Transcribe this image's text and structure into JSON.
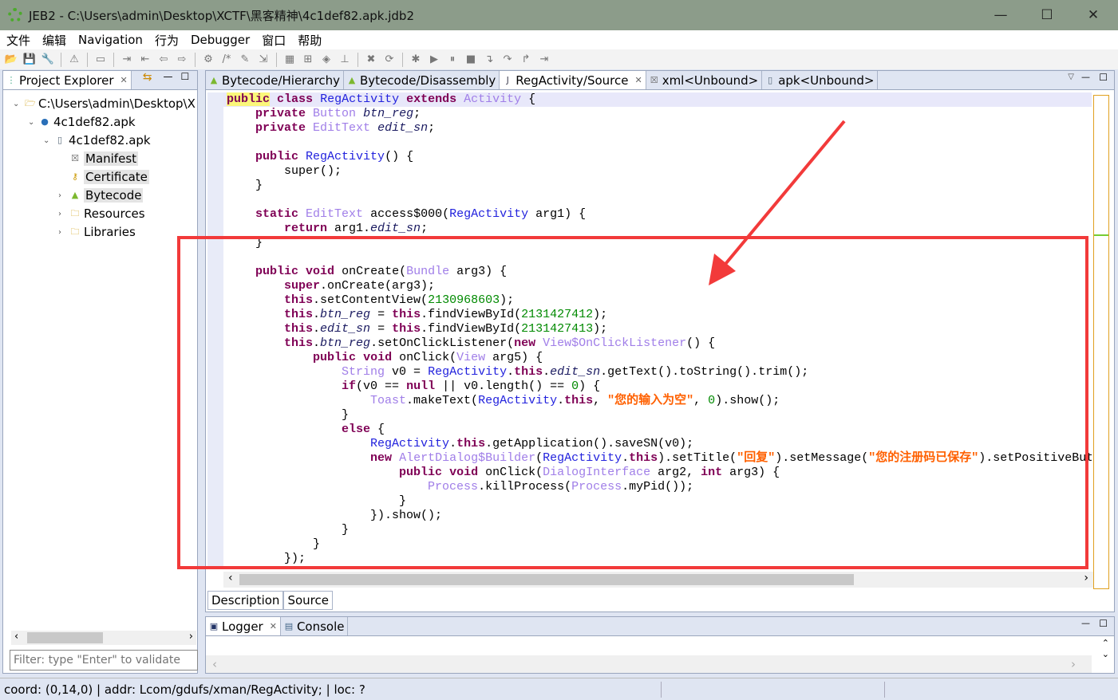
{
  "window": {
    "title": "JEB2 - C:\\Users\\admin\\Desktop\\XCTF\\黑客精神\\4c1def82.apk.jdb2",
    "minimize": "—",
    "maximize": "☐",
    "close": "✕"
  },
  "menu": [
    "文件",
    "编辑",
    "Navigation",
    "行为",
    "Debugger",
    "窗口",
    "帮助"
  ],
  "toolbar": [
    "open-icon",
    "save-icon",
    "wrench-icon",
    "warning-icon",
    "new-icon",
    "jump-icon",
    "import-icon",
    "back-icon",
    "forward-icon",
    "gears-icon",
    "comment-icon",
    "pencil-icon",
    "export-icon",
    "grid-icon",
    "grid2-icon",
    "nav-icon",
    "tree-icon",
    "delete-icon",
    "refresh-icon",
    "bug-icon",
    "run-icon",
    "pause-icon",
    "stop-icon",
    "step-into-icon",
    "step-over-icon",
    "step-out-icon",
    "run-to-icon"
  ],
  "project_explorer": {
    "title": "Project Explorer",
    "tree": [
      {
        "label": "C:\\Users\\admin\\Desktop\\X",
        "level": 0,
        "icon": "folder-open-icon",
        "expanded": true
      },
      {
        "label": "4c1def82.apk",
        "level": 1,
        "icon": "dot-icon",
        "expanded": true
      },
      {
        "label": "4c1def82.apk",
        "level": 2,
        "icon": "apk-icon",
        "expanded": true
      },
      {
        "label": "Manifest",
        "level": 3,
        "icon": "xml-icon",
        "selected": true
      },
      {
        "label": "Certificate",
        "level": 3,
        "icon": "key-icon",
        "selected": true
      },
      {
        "label": "Bytecode",
        "level": 3,
        "icon": "android-icon",
        "selected": true,
        "collapsed": true
      },
      {
        "label": "Resources",
        "level": 3,
        "icon": "folder-icon",
        "collapsed": true
      },
      {
        "label": "Libraries",
        "level": 3,
        "icon": "folder-icon",
        "collapsed": true
      }
    ],
    "filter_placeholder": "Filter: type \"Enter\" to validate"
  },
  "editor": {
    "tabs": [
      {
        "label": "Bytecode/Hierarchy",
        "icon": "android-icon"
      },
      {
        "label": "Bytecode/Disassembly",
        "icon": "android-icon"
      },
      {
        "label": "RegActivity/Source",
        "icon": "java-icon",
        "active": true,
        "closable": true
      },
      {
        "label": "xml<Unbound>",
        "icon": "xml-icon"
      },
      {
        "label": "apk<Unbound>",
        "icon": "apk-icon"
      }
    ],
    "bottom_tabs": [
      "Description",
      "Source"
    ],
    "code": [
      [
        0,
        [
          [
            "hl k",
            "public"
          ],
          [
            "p",
            " "
          ],
          [
            "k",
            "class"
          ],
          [
            "p",
            " "
          ],
          [
            "c",
            "RegActivity"
          ],
          [
            "p",
            " "
          ],
          [
            "k",
            "extends"
          ],
          [
            "p",
            " "
          ],
          [
            "t",
            "Activity"
          ],
          [
            "p",
            " {"
          ]
        ]
      ],
      [
        1,
        [
          [
            "k",
            "private"
          ],
          [
            "p",
            " "
          ],
          [
            "t",
            "Button"
          ],
          [
            "p",
            " "
          ],
          [
            "f",
            "btn_reg"
          ],
          [
            "p",
            ";"
          ]
        ]
      ],
      [
        1,
        [
          [
            "k",
            "private"
          ],
          [
            "p",
            " "
          ],
          [
            "t",
            "EditText"
          ],
          [
            "p",
            " "
          ],
          [
            "f",
            "edit_sn"
          ],
          [
            "p",
            ";"
          ]
        ]
      ],
      [
        0,
        []
      ],
      [
        1,
        [
          [
            "k",
            "public"
          ],
          [
            "p",
            " "
          ],
          [
            "c",
            "RegActivity"
          ],
          [
            "p",
            "() {"
          ]
        ]
      ],
      [
        2,
        [
          [
            "p",
            "super();"
          ]
        ]
      ],
      [
        1,
        [
          [
            "p",
            "}"
          ]
        ]
      ],
      [
        0,
        []
      ],
      [
        1,
        [
          [
            "k",
            "static"
          ],
          [
            "p",
            " "
          ],
          [
            "t",
            "EditText"
          ],
          [
            "p",
            " access$000("
          ],
          [
            "c",
            "RegActivity"
          ],
          [
            "p",
            " arg1) {"
          ]
        ]
      ],
      [
        2,
        [
          [
            "k",
            "return"
          ],
          [
            "p",
            " arg1."
          ],
          [
            "f",
            "edit_sn"
          ],
          [
            "p",
            ";"
          ]
        ]
      ],
      [
        1,
        [
          [
            "p",
            "}"
          ]
        ]
      ],
      [
        0,
        []
      ],
      [
        1,
        [
          [
            "k",
            "public"
          ],
          [
            "p",
            " "
          ],
          [
            "k",
            "void"
          ],
          [
            "p",
            " onCreate("
          ],
          [
            "t",
            "Bundle"
          ],
          [
            "p",
            " arg3) {"
          ]
        ]
      ],
      [
        2,
        [
          [
            "k",
            "super"
          ],
          [
            "p",
            ".onCreate(arg3);"
          ]
        ]
      ],
      [
        2,
        [
          [
            "k",
            "this"
          ],
          [
            "p",
            ".setContentView("
          ],
          [
            "n",
            "2130968603"
          ],
          [
            "p",
            ");"
          ]
        ]
      ],
      [
        2,
        [
          [
            "k",
            "this"
          ],
          [
            "p",
            "."
          ],
          [
            "f",
            "btn_reg"
          ],
          [
            "p",
            " = "
          ],
          [
            "k",
            "this"
          ],
          [
            "p",
            ".findViewById("
          ],
          [
            "n",
            "2131427412"
          ],
          [
            "p",
            ");"
          ]
        ]
      ],
      [
        2,
        [
          [
            "k",
            "this"
          ],
          [
            "p",
            "."
          ],
          [
            "f",
            "edit_sn"
          ],
          [
            "p",
            " = "
          ],
          [
            "k",
            "this"
          ],
          [
            "p",
            ".findViewById("
          ],
          [
            "n",
            "2131427413"
          ],
          [
            "p",
            ");"
          ]
        ]
      ],
      [
        2,
        [
          [
            "k",
            "this"
          ],
          [
            "p",
            "."
          ],
          [
            "f",
            "btn_reg"
          ],
          [
            "p",
            ".setOnClickListener("
          ],
          [
            "k",
            "new"
          ],
          [
            "p",
            " "
          ],
          [
            "t",
            "View$OnClickListener"
          ],
          [
            "p",
            "() {"
          ]
        ]
      ],
      [
        3,
        [
          [
            "k",
            "public"
          ],
          [
            "p",
            " "
          ],
          [
            "k",
            "void"
          ],
          [
            "p",
            " onClick("
          ],
          [
            "t",
            "View"
          ],
          [
            "p",
            " arg5) {"
          ]
        ]
      ],
      [
        4,
        [
          [
            "t",
            "String"
          ],
          [
            "p",
            " v0 = "
          ],
          [
            "c",
            "RegActivity"
          ],
          [
            "p",
            "."
          ],
          [
            "k",
            "this"
          ],
          [
            "p",
            "."
          ],
          [
            "f",
            "edit_sn"
          ],
          [
            "p",
            ".getText().toString().trim();"
          ]
        ]
      ],
      [
        4,
        [
          [
            "k",
            "if"
          ],
          [
            "p",
            "(v0 == "
          ],
          [
            "k",
            "null"
          ],
          [
            "p",
            " || v0.length() == "
          ],
          [
            "n",
            "0"
          ],
          [
            "p",
            ") {"
          ]
        ]
      ],
      [
        5,
        [
          [
            "t",
            "Toast"
          ],
          [
            "p",
            ".makeText("
          ],
          [
            "c",
            "RegActivity"
          ],
          [
            "p",
            "."
          ],
          [
            "k",
            "this"
          ],
          [
            "p",
            ", "
          ],
          [
            "s",
            "\"您的输入为空\""
          ],
          [
            "p",
            ", "
          ],
          [
            "n",
            "0"
          ],
          [
            "p",
            ").show();"
          ]
        ]
      ],
      [
        4,
        [
          [
            "p",
            "}"
          ]
        ]
      ],
      [
        4,
        [
          [
            "k",
            "else"
          ],
          [
            "p",
            " {"
          ]
        ]
      ],
      [
        5,
        [
          [
            "c",
            "RegActivity"
          ],
          [
            "p",
            "."
          ],
          [
            "k",
            "this"
          ],
          [
            "p",
            ".getApplication().saveSN(v0);"
          ]
        ]
      ],
      [
        5,
        [
          [
            "k",
            "new"
          ],
          [
            "p",
            " "
          ],
          [
            "t",
            "AlertDialog$Builder"
          ],
          [
            "p",
            "("
          ],
          [
            "c",
            "RegActivity"
          ],
          [
            "p",
            "."
          ],
          [
            "k",
            "this"
          ],
          [
            "p",
            ").setTitle("
          ],
          [
            "s",
            "\"回复\""
          ],
          [
            "p",
            ").setMessage("
          ],
          [
            "s",
            "\"您的注册码已保存\""
          ],
          [
            "p",
            ").setPositiveButt"
          ]
        ]
      ],
      [
        6,
        [
          [
            "k",
            "public"
          ],
          [
            "p",
            " "
          ],
          [
            "k",
            "void"
          ],
          [
            "p",
            " onClick("
          ],
          [
            "t",
            "DialogInterface"
          ],
          [
            "p",
            " arg2, "
          ],
          [
            "k",
            "int"
          ],
          [
            "p",
            " arg3) {"
          ]
        ]
      ],
      [
        7,
        [
          [
            "t",
            "Process"
          ],
          [
            "p",
            ".killProcess("
          ],
          [
            "t",
            "Process"
          ],
          [
            "p",
            ".myPid());"
          ]
        ]
      ],
      [
        6,
        [
          [
            "p",
            "}"
          ]
        ]
      ],
      [
        5,
        [
          [
            "p",
            "}).show();"
          ]
        ]
      ],
      [
        4,
        [
          [
            "p",
            "}"
          ]
        ]
      ],
      [
        3,
        [
          [
            "p",
            "}"
          ]
        ]
      ],
      [
        2,
        [
          [
            "p",
            "});"
          ]
        ]
      ]
    ]
  },
  "bottom_panel": {
    "tabs": [
      "Logger",
      "Console"
    ]
  },
  "status": "coord: (0,14,0) | addr: Lcom/gdufs/xman/RegActivity; | loc: ?",
  "annotation_color": "#f23a3a"
}
